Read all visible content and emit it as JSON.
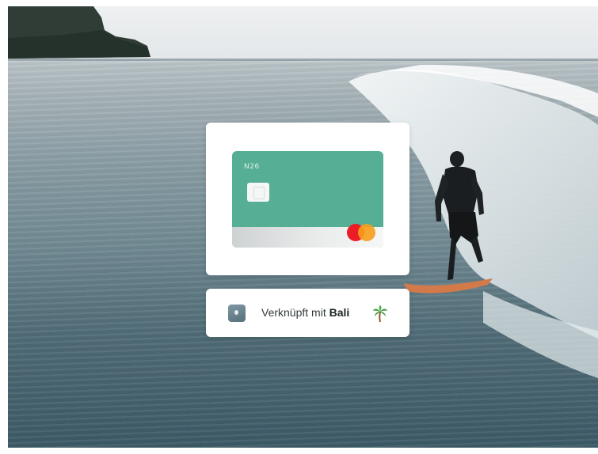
{
  "card": {
    "logo_text": "N26",
    "network": "mastercard",
    "color": "#56ae94"
  },
  "linked": {
    "prefix": "Verknüpft mit",
    "place": "Bali",
    "emoji": "palm-tree-icon"
  }
}
